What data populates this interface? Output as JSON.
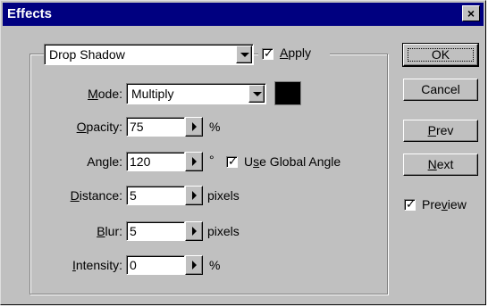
{
  "window": {
    "title": "Effects",
    "close_glyph": "×"
  },
  "effect": {
    "selected": "Drop Shadow",
    "apply_checked": true,
    "apply_label_pre": "",
    "apply_label_underlined": "A",
    "apply_label_post": "pply"
  },
  "fields": {
    "mode": {
      "label_u": "M",
      "label_rest": "ode:",
      "value": "Multiply"
    },
    "opacity": {
      "label_u": "O",
      "label_rest": "pacity:",
      "value": "75",
      "unit": "%"
    },
    "angle": {
      "label_pre": "Angle:",
      "value": "120",
      "unit": "°"
    },
    "distance": {
      "label_u": "D",
      "label_rest": "istance:",
      "value": "5",
      "unit": "pixels"
    },
    "blur": {
      "label_u": "B",
      "label_rest": "lur:",
      "value": "5",
      "unit": "pixels"
    },
    "intensity": {
      "label_u": "I",
      "label_rest": "ntensity:",
      "value": "0",
      "unit": "%"
    }
  },
  "global_angle": {
    "checked": true,
    "label_pre": "U",
    "label_u": "s",
    "label_post": "e Global Angle"
  },
  "shadow_color": "#000000",
  "buttons": {
    "ok": "OK",
    "cancel": "Cancel",
    "prev_u": "P",
    "prev_rest": "rev",
    "next_u": "N",
    "next_rest": "ext"
  },
  "preview": {
    "checked": true,
    "label_pre": "Pre",
    "label_u": "v",
    "label_post": "iew"
  }
}
